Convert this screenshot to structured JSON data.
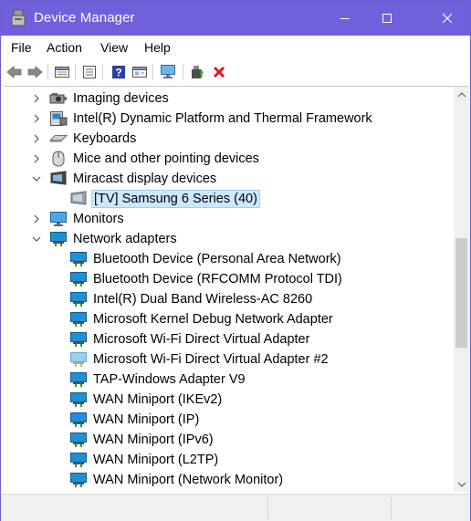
{
  "window": {
    "title": "Device Manager"
  },
  "menu": {
    "items": [
      "File",
      "Action",
      "View",
      "Help"
    ]
  },
  "toolbar": {
    "buttons": [
      "back-icon",
      "forward-icon",
      "properties-sheet-icon",
      "list-view-icon",
      "help-icon",
      "action-sheet-icon",
      "scan-hardware-icon",
      "update-driver-icon",
      "uninstall-icon"
    ]
  },
  "tree": {
    "imaging": "Imaging devices",
    "intel_dptf": "Intel(R) Dynamic Platform and Thermal Framework",
    "keyboards": "Keyboards",
    "mice": "Mice and other pointing devices",
    "miracast": "Miracast display devices",
    "miracast_child": "[TV] Samsung 6 Series (40)",
    "monitors": "Monitors",
    "network": "Network adapters",
    "network_children": [
      "Bluetooth Device (Personal Area Network)",
      "Bluetooth Device (RFCOMM Protocol TDI)",
      "Intel(R) Dual Band Wireless-AC 8260",
      "Microsoft Kernel Debug Network Adapter",
      "Microsoft Wi-Fi Direct Virtual Adapter",
      "Microsoft Wi-Fi Direct Virtual Adapter #2",
      "TAP-Windows Adapter V9",
      "WAN Miniport (IKEv2)",
      "WAN Miniport (IP)",
      "WAN Miniport (IPv6)",
      "WAN Miniport (L2TP)",
      "WAN Miniport (Network Monitor)"
    ]
  },
  "colors": {
    "titlebar": "#7060db",
    "selection": "#cce8ff",
    "network_icon": "#1e90d6",
    "delete_red": "#e81123"
  }
}
